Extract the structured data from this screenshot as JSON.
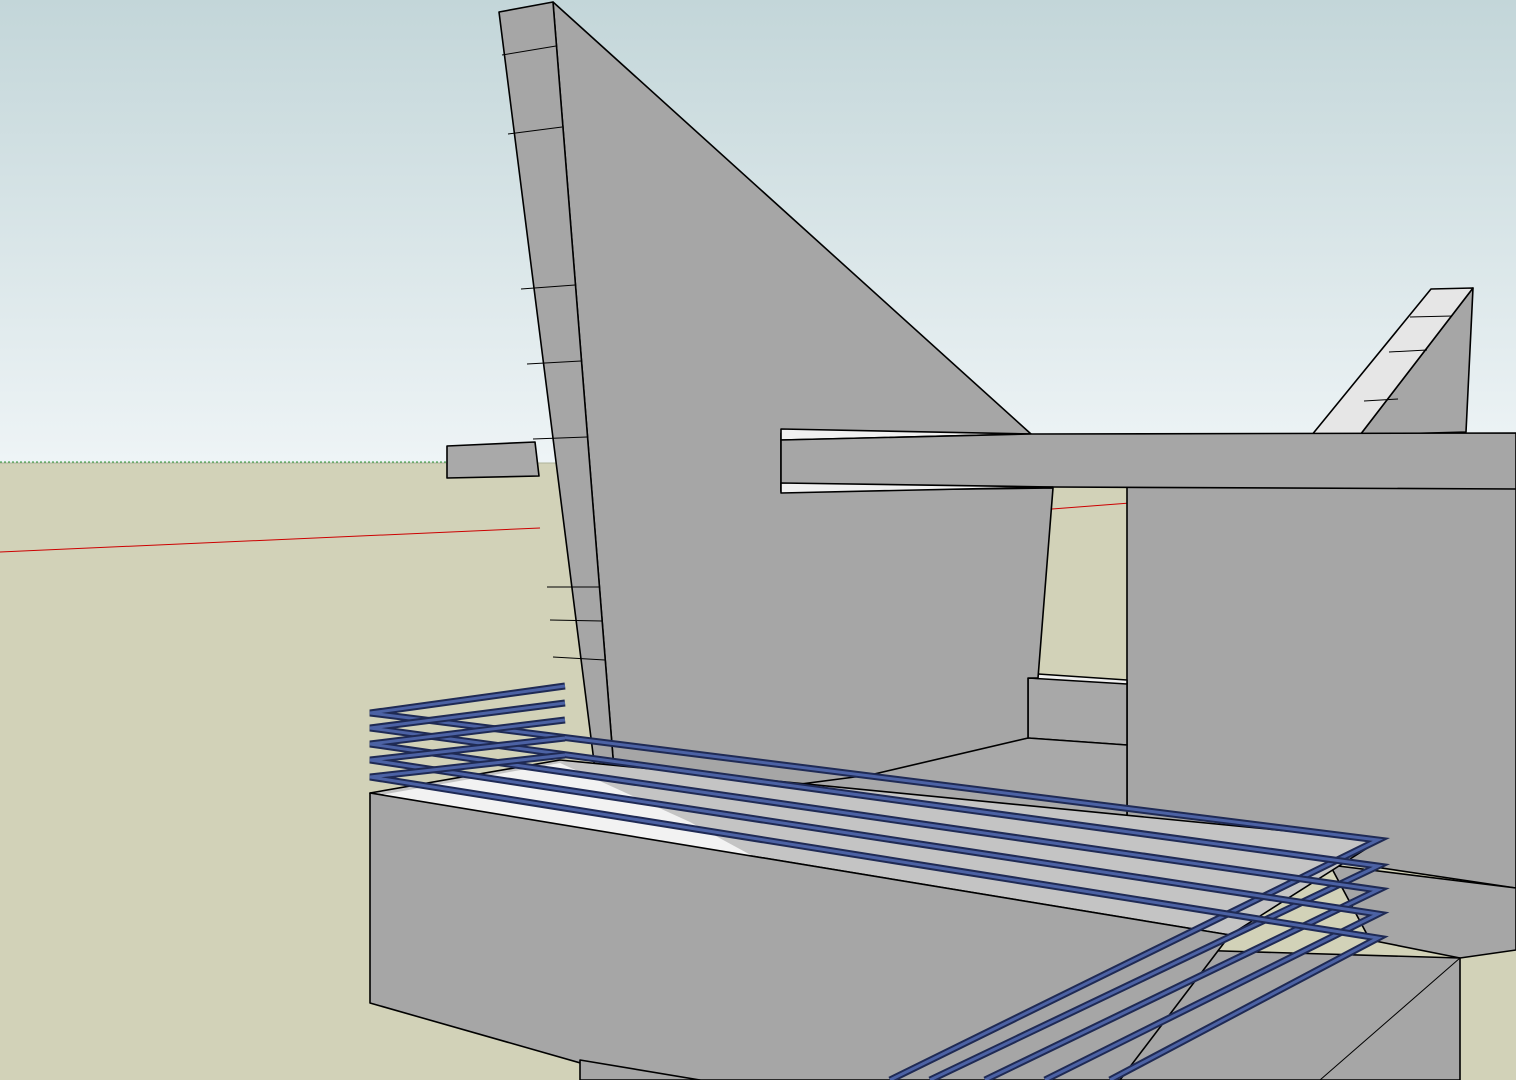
{
  "app": {
    "name": "",
    "view": "3d-model-viewport"
  },
  "colors": {
    "sky_top": "#c3d6d9",
    "sky_bottom": "#eef4f6",
    "ground": "#d2d2b8",
    "face_gray": "#a6a6a6",
    "face_light": "#c7c7c7",
    "face_white": "#ececec",
    "edge": "#000000",
    "rail_dark": "#1f2a54",
    "rail_blue": "#4c62a4",
    "axis_red": "#cc0000",
    "axis_green": "#2f9a3a"
  },
  "scene": {
    "axes": [
      "red-axis",
      "green-axis"
    ],
    "objects": [
      "triangular-fin-wall",
      "secondary-fin",
      "cantilever-beam",
      "stub-beam",
      "back-wall",
      "parapet-block",
      "balcony-slab",
      "lower-step-block",
      "blue-railing"
    ]
  }
}
